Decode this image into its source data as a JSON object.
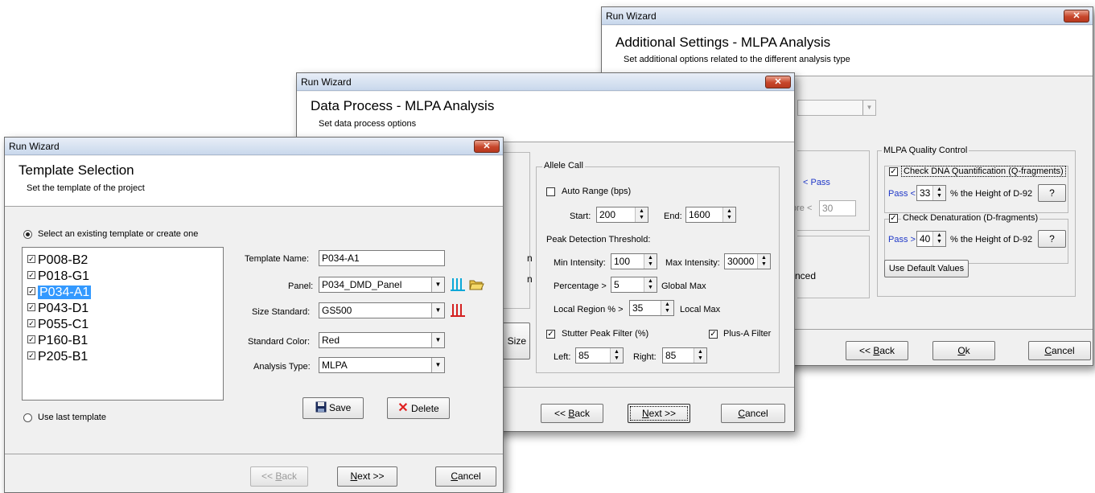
{
  "win3": {
    "title": "Run Wizard",
    "close": "✕",
    "header_title": "Additional Settings - MLPA Analysis",
    "header_subtitle": "Set additional options related to the different analysis type",
    "pass_link": "< Pass",
    "score_label_partial": "ore <",
    "score_value": "30",
    "advanced_partial": "nced",
    "qc_group": "MLPA Quality Control",
    "q_check_label": "Check DNA Quantification (Q-fragments)",
    "q_pass": "Pass <",
    "q_value": "33",
    "q_suffix": "% the Height of D-92",
    "q_help": "?",
    "d_check_label": "Check Denaturation (D-fragments)",
    "d_pass": "Pass >",
    "d_value": "40",
    "d_suffix": "% the Height of D-92",
    "d_help": "?",
    "default_button": "Use Default Values",
    "back_prefix": "<< ",
    "back_key": "B",
    "back_rest": "ack",
    "ok_key": "O",
    "ok_rest": "k",
    "cancel_key": "C",
    "cancel_rest": "ancel"
  },
  "win2": {
    "title": "Run Wizard",
    "close": "✕",
    "header_title": "Data Process - MLPA Analysis",
    "header_subtitle": "Set data process options",
    "allele_group": "Allele Call",
    "auto_range": "Auto Range (bps)",
    "start_label": "Start:",
    "start_value": "200",
    "end_label": "End:",
    "end_value": "1600",
    "peak_threshold": "Peak Detection Threshold:",
    "min_int_label": "Min Intensity:",
    "min_int_value": "100",
    "max_int_label": "Max Intensity:",
    "max_int_value": "30000",
    "percentage_label": "Percentage >",
    "percentage_value": "5",
    "global_max": "Global Max",
    "local_region_label": "Local Region % >",
    "local_region_value": "35",
    "local_max": "Local Max",
    "stutter_label": "Stutter Peak Filter (%)",
    "plusa_label": "Plus-A Filter",
    "left_label": "Left:",
    "left_value": "85",
    "right_label": "Right:",
    "right_value": "85",
    "size_partial": "Size",
    "n1": "n",
    "n2": "n",
    "back_prefix": "<< ",
    "back_key": "B",
    "back_rest": "ack",
    "next_key": "N",
    "next_rest": "ext >>",
    "cancel_key": "C",
    "cancel_rest": "ancel"
  },
  "win1": {
    "title": "Run Wizard",
    "close": "✕",
    "header_title": "Template Selection",
    "header_subtitle": "Set the template of the project",
    "select_existing": "Select an existing template or create one",
    "templates": [
      "P008-B2",
      "P018-G1",
      "P034-A1",
      "P043-D1",
      "P055-C1",
      "P160-B1",
      "P205-B1"
    ],
    "selected_template": "P034-A1",
    "template_name_label": "Template Name:",
    "template_name_value": "P034-A1",
    "panel_label": "Panel:",
    "panel_value": "P034_DMD_Panel",
    "size_standard_label": "Size Standard:",
    "size_standard_value": "GS500",
    "standard_color_label": "Standard Color:",
    "standard_color_value": "Red",
    "analysis_type_label": "Analysis Type:",
    "analysis_type_value": "MLPA",
    "save_button": "Save",
    "delete_button": "Delete",
    "use_last": "Use last template",
    "back_prefix": "<< ",
    "back_key": "B",
    "back_rest": "ack",
    "next_key": "N",
    "next_rest": "ext >>",
    "cancel_key": "C",
    "cancel_rest": "ancel"
  },
  "colors": {
    "link_blue": "#1f38c8",
    "selection": "#3399ff",
    "close_red": "#c7452a",
    "delete_red": "#e02020"
  },
  "icons": {
    "panel_bar": "panel-bars-icon",
    "open_folder": "folder-open-icon",
    "size_bar": "size-standard-bars-icon",
    "save": "floppy-disk-icon",
    "delete": "red-x-icon"
  }
}
